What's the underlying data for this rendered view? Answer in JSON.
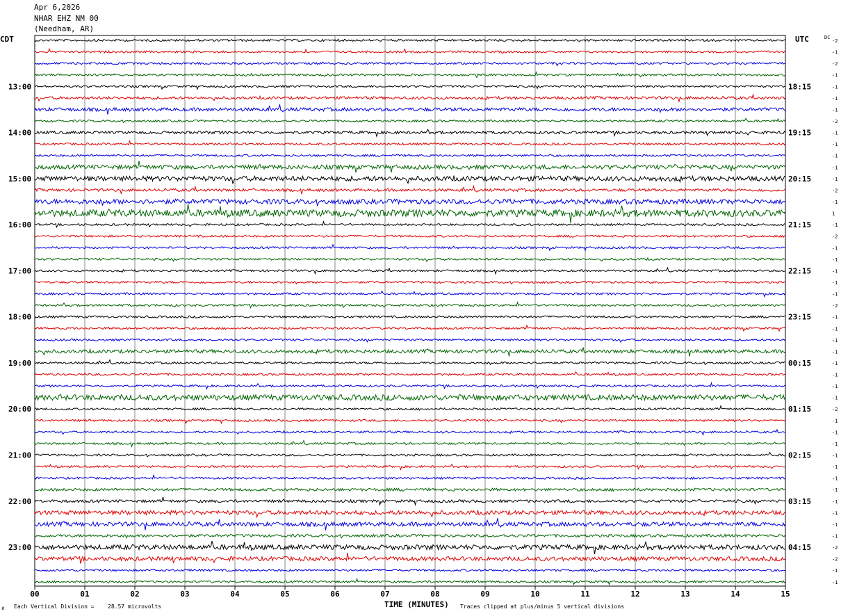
{
  "header": {
    "date": "Apr 6,2026",
    "station": "NHAR EHZ NM 00",
    "location": "(Needham, AR)"
  },
  "labels": {
    "left_tz": "CDT",
    "right_tz": "UTC",
    "dc_label": "DC",
    "x_title": "TIME (MINUTES)",
    "vertical_division_label": "Each Vertical Division =",
    "vertical_division_value": "28.57 microvolts",
    "clip_note": "Traces clipped at plus/minus 5 vertical divisions",
    "corner_mark": "∧"
  },
  "colors": {
    "trace_cycle": [
      "#000000",
      "#e00000",
      "#0000e0",
      "#006400"
    ],
    "grid": "#888888"
  },
  "chart_data": {
    "type": "line",
    "description_axis": "helicorder",
    "x_ticks": [
      "00",
      "01",
      "02",
      "03",
      "04",
      "05",
      "06",
      "07",
      "08",
      "09",
      "10",
      "11",
      "12",
      "13",
      "14",
      "15"
    ],
    "xlim": [
      0,
      15
    ],
    "left_hour_labels": [
      "13:00",
      "14:00",
      "15:00",
      "16:00",
      "17:00",
      "18:00",
      "19:00",
      "20:00",
      "21:00",
      "22:00",
      "23:00"
    ],
    "right_hour_labels": [
      "18:15",
      "19:15",
      "20:15",
      "21:15",
      "22:15",
      "23:15",
      "00:15",
      "01:15",
      "02:15",
      "03:15",
      "04:15"
    ],
    "dc_values": [
      "-2",
      "-1",
      "-2",
      "-1",
      "-1",
      "-1",
      "-1",
      "-2",
      "-1",
      "-1",
      "-1",
      "-1",
      "-1",
      "-2",
      "-1",
      "1",
      "-1",
      "-2",
      "-1",
      "-1",
      "-1",
      "-1",
      "-1",
      "-2",
      "-1",
      "-1",
      "-1",
      "-1",
      "-1",
      "-1",
      "-1",
      "-1",
      "-2",
      "-1",
      "-1",
      "-1",
      "-1",
      "-1",
      "-1",
      "-1",
      "-1",
      "-1",
      "-1",
      "-1",
      "-2",
      "-2",
      "-1",
      "-1"
    ],
    "amplitudes": [
      1.5,
      1.5,
      1.5,
      1.5,
      1.5,
      2,
      2.5,
      1.5,
      2,
      1.5,
      1.5,
      3,
      3.5,
      2,
      3.5,
      5,
      1.5,
      1.5,
      1.5,
      1.5,
      1.5,
      1.5,
      1.5,
      1.5,
      1.5,
      1.5,
      1.5,
      2.5,
      1.5,
      1.5,
      1.5,
      4,
      1.5,
      1.5,
      1.5,
      1.5,
      1.5,
      1.5,
      1.5,
      2,
      2,
      3,
      3,
      2,
      3.5,
      3,
      1.5,
      1.5
    ]
  }
}
